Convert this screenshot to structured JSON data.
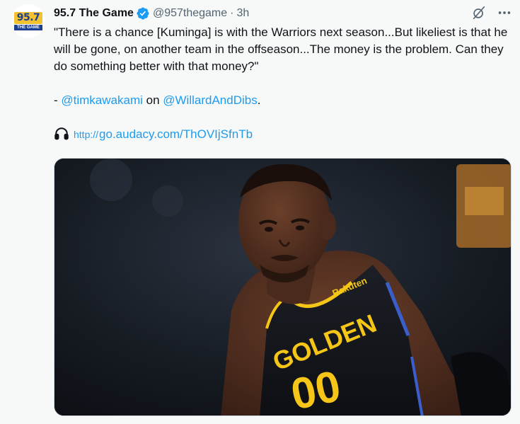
{
  "tweet": {
    "display_name": "95.7 The Game",
    "handle": "@957thegame",
    "separator": "·",
    "time": "3h",
    "verified": true,
    "avatar_logo_text": "95.7",
    "avatar_logo_subtext": "THE GAME",
    "body_lines": [
      "\"There is a chance [Kuminga] is with the Warriors next season...But likeliest is that he will be gone, on another team in the offseason...The money is the problem. Can they do something better with that money?\""
    ],
    "credit_prefix": "- ",
    "credit_mention_1": "@timkawakami",
    "credit_middle": " on ",
    "credit_mention_2": "@WillardAndDibs",
    "credit_suffix": ".",
    "link_proto": "http://",
    "link_text": "go.audacy.com/ThOVIjSfnTb",
    "jersey_sponsor": "Rakuten",
    "jersey_word": "GOLDEN",
    "jersey_number": "00"
  },
  "icons": {
    "verified": "verified-badge-icon",
    "grok": "grok-icon",
    "more": "more-icon",
    "link": "headphones-icon"
  },
  "colors": {
    "accent": "#1d9bf0",
    "text": "#0f1419",
    "secondary": "#536471",
    "background": "#f7f9f9",
    "jersey_gold": "#f5c518"
  }
}
